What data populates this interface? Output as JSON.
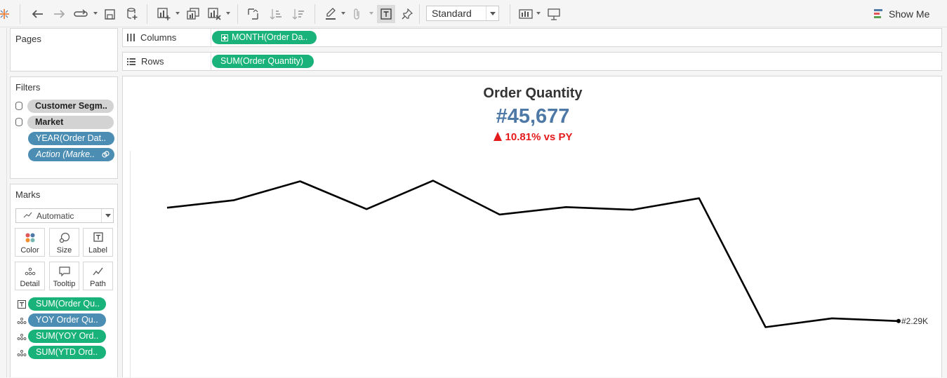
{
  "toolbar": {
    "icons": [
      "tableau-logo-icon",
      "undo-icon",
      "redo-icon",
      "swap-loop-icon",
      "save-icon",
      "new-datasource-icon",
      "new-worksheet-icon",
      "duplicate-icon",
      "clear-sheet-icon",
      "swap-axes-icon",
      "sort-ascending-icon",
      "sort-descending-icon",
      "highlight-pen-icon",
      "group-paperclip-icon",
      "show-labels-icon",
      "pin-icon",
      "show-cards-icon",
      "presentation-icon"
    ],
    "fit_select": "Standard",
    "show_me_label": "Show Me",
    "colors": {
      "show_me_icon": [
        "#4e79a7",
        "#e15759",
        "#59a14f"
      ]
    }
  },
  "pages": {
    "title": "Pages"
  },
  "filters": {
    "title": "Filters",
    "items": [
      {
        "label": "Customer Segm..",
        "style": "gray",
        "icon": "database-icon"
      },
      {
        "label": "Market",
        "style": "gray",
        "icon": "database-icon"
      },
      {
        "label": "YEAR(Order Dat..",
        "style": "blue"
      },
      {
        "label": "Action (Marke..",
        "style": "blue-italic",
        "icon": "link-icon"
      }
    ]
  },
  "marks": {
    "title": "Marks",
    "type": "Automatic",
    "buttons": [
      "Color",
      "Size",
      "Label",
      "Detail",
      "Tooltip",
      "Path"
    ],
    "pills": [
      {
        "label": "SUM(Order Qu..",
        "style": "green",
        "icon": "label-icon"
      },
      {
        "label": "YOY Order Qu..",
        "style": "blue",
        "icon": "detail-icon"
      },
      {
        "label": "SUM(YOY Ord..",
        "style": "green",
        "icon": "detail-icon"
      },
      {
        "label": "SUM(YTD Ord..",
        "style": "green",
        "icon": "detail-icon"
      }
    ]
  },
  "shelves": {
    "columns": {
      "label": "Columns",
      "pill": "MONTH(Order Da.."
    },
    "rows": {
      "label": "Rows",
      "pill": "SUM(Order Quantity)"
    }
  },
  "view": {
    "title": "Order Quantity",
    "kpi": "#45,677",
    "delta": "10.81% vs PY",
    "colors": {
      "kpi": "#4e79a7",
      "delta": "#e41a1c",
      "pill_green": "#19b27a",
      "pill_blue": "#4c8db3"
    }
  },
  "chart_data": {
    "type": "line",
    "x": [
      1,
      2,
      3,
      4,
      5,
      6,
      7,
      8,
      9,
      10,
      11,
      12
    ],
    "values": [
      3960,
      4070,
      4350,
      3940,
      4360,
      3860,
      3970,
      3930,
      4100,
      2200,
      2330,
      2290
    ],
    "end_label": "#2.29K",
    "color": "#000000",
    "ylim": [
      1450,
      4800
    ],
    "xlabel": "",
    "ylabel": "",
    "grid": false
  }
}
